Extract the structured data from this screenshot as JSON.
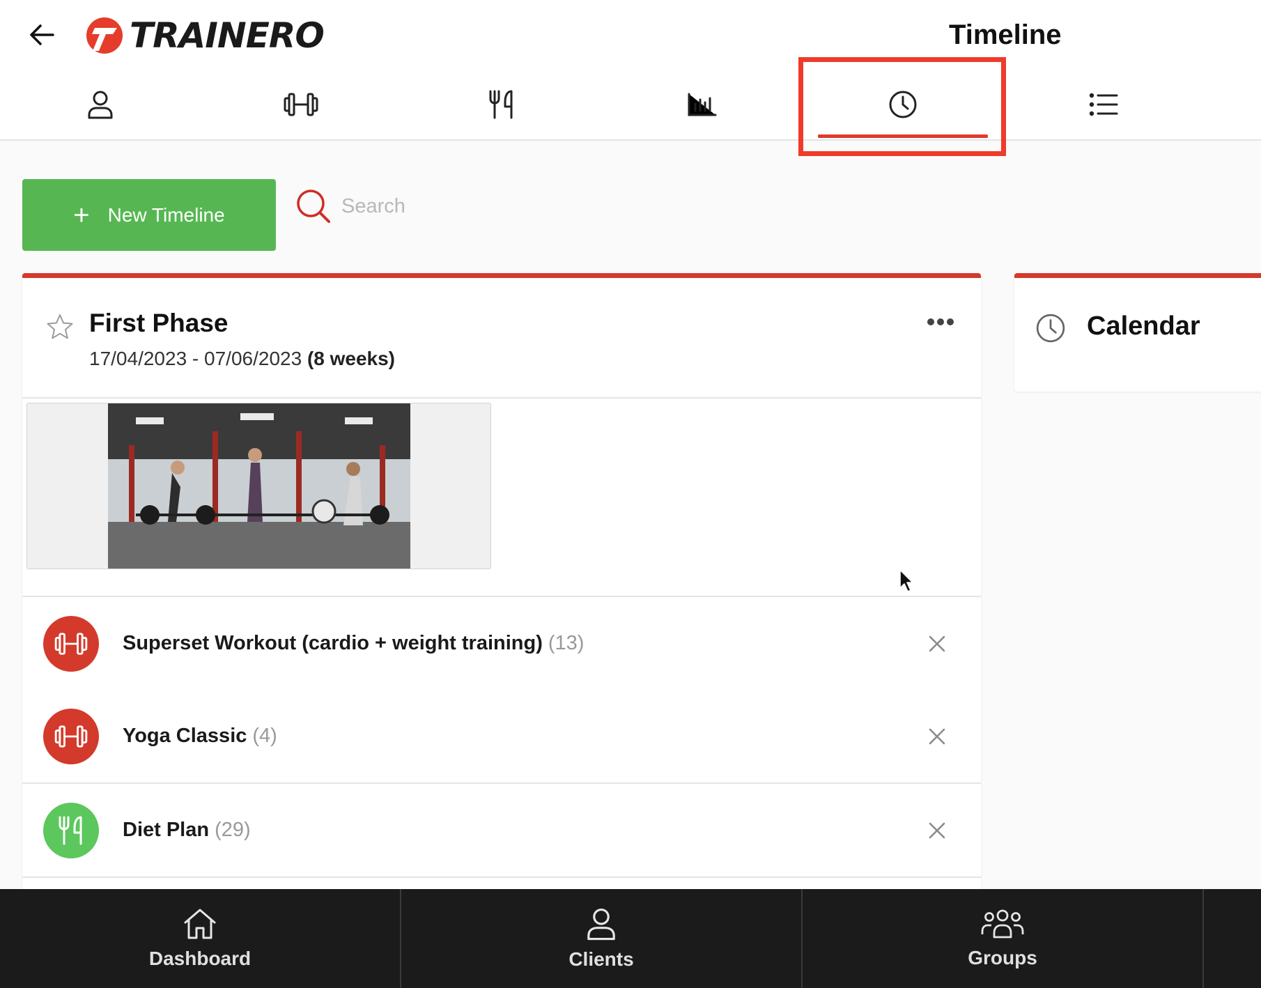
{
  "header": {
    "brand": "TRAINERO",
    "title": "Timeline",
    "tabs": [
      {
        "icon": "user-icon"
      },
      {
        "icon": "dumbbell-icon"
      },
      {
        "icon": "fork-knife-icon"
      },
      {
        "icon": "bar-chart-icon"
      },
      {
        "icon": "clock-icon",
        "active": true
      },
      {
        "icon": "list-icon"
      }
    ]
  },
  "toolbar": {
    "new_label": "New Timeline",
    "search_placeholder": "Search"
  },
  "timeline": {
    "title": "First Phase",
    "dates": "17/04/2023 - 07/06/2023",
    "duration": "(8 weeks)",
    "items": [
      {
        "icon": "dumbbell-icon",
        "label": "Superset Workout (cardio + weight training)",
        "count": "(13)",
        "color": "#d33a2b"
      },
      {
        "icon": "dumbbell-icon",
        "label": "Yoga Classic",
        "count": "(4)",
        "color": "#d33a2b"
      },
      {
        "icon": "fork-knife-icon",
        "label": "Diet Plan",
        "count": "(29)",
        "color": "#5cc75c"
      }
    ]
  },
  "calendar": {
    "title": "Calendar"
  },
  "bottom_nav": {
    "dashboard": "Dashboard",
    "clients": "Clients",
    "groups": "Groups"
  },
  "colors": {
    "accent": "#d33a2b",
    "green": "#56b752",
    "highlight": "#ef3b29"
  }
}
